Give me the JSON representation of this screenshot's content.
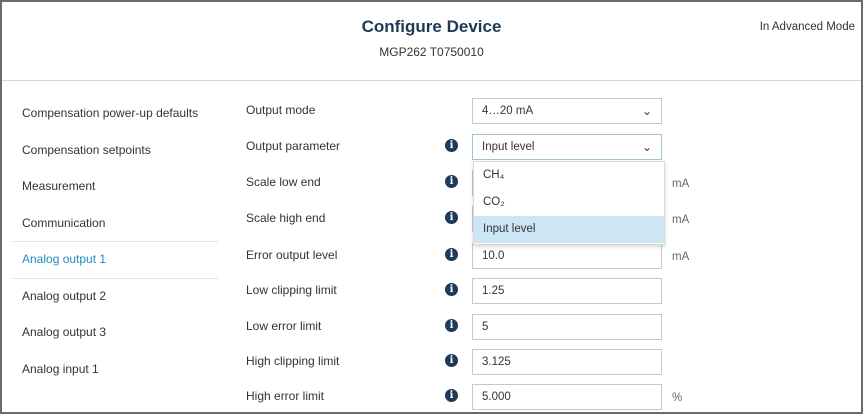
{
  "header": {
    "title": "Configure Device",
    "subtitle": "MGP262 T0750010",
    "mode": "In Advanced Mode"
  },
  "nav": {
    "items": [
      {
        "label": "Compensation power-up defaults"
      },
      {
        "label": "Compensation setpoints"
      },
      {
        "label": "Measurement"
      },
      {
        "label": "Communication"
      },
      {
        "label": "Analog output 1",
        "active": true
      },
      {
        "label": "Analog output 2"
      },
      {
        "label": "Analog output 3"
      },
      {
        "label": "Analog input 1"
      }
    ]
  },
  "form": {
    "output_mode": {
      "label": "Output mode",
      "value": "4…20 mA"
    },
    "output_parameter": {
      "label": "Output parameter",
      "value": "Input level",
      "options": [
        "CH₄",
        "CO₂",
        "Input level"
      ]
    },
    "scale_low": {
      "label": "Scale low end",
      "unit": "mA"
    },
    "scale_high": {
      "label": "Scale high end",
      "unit": "mA"
    },
    "error_output": {
      "label": "Error output level",
      "value": "10.0",
      "unit": "mA"
    },
    "low_clipping": {
      "label": "Low clipping limit",
      "value": "1.25"
    },
    "low_error": {
      "label": "Low error limit",
      "value": "5"
    },
    "high_clipping": {
      "label": "High clipping limit",
      "value": "3.125"
    },
    "high_error": {
      "label": "High error limit",
      "value": "5.000",
      "unit": "%"
    }
  },
  "icons": {
    "info": "info-icon",
    "chevron": "chevron-down-icon"
  },
  "colors": {
    "title": "#1d3a57",
    "active": "#1e8fc1",
    "selected_option": "#cde6f3"
  }
}
